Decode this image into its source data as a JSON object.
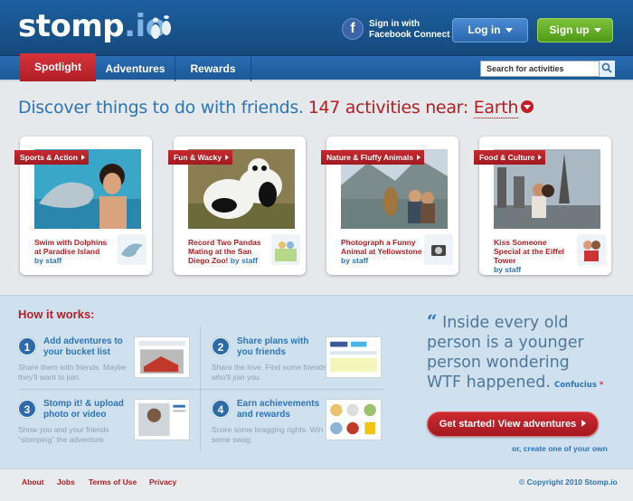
{
  "header": {
    "logo": "stomp",
    "logo_suffix": ".io",
    "facebook": {
      "line1": "Sign in with",
      "line2": "Facebook Connect"
    },
    "login_label": "Log in",
    "signup_label": "Sign up"
  },
  "nav": {
    "tabs": [
      {
        "label": "Spotlight",
        "active": true
      },
      {
        "label": "Adventures",
        "active": false
      },
      {
        "label": "Rewards",
        "active": false
      }
    ],
    "search_placeholder": "Search for activities"
  },
  "headline": {
    "text": "Discover things to do with friends.",
    "count": "147 activities near:",
    "location": "Earth"
  },
  "cards": [
    {
      "tag": "Sports & Action",
      "title": "Swim with Dolphins at Paradise Island",
      "by": "by staff"
    },
    {
      "tag": "Fun & Wacky",
      "title": "Record Two Pandas Mating at the San Diego Zoo!",
      "by": "by staff"
    },
    {
      "tag": "Nature & Fluffy Animals",
      "title": "Photograph a Funny Animal at Yellowstone",
      "by": "by staff"
    },
    {
      "tag": "Food & Culture",
      "title": "Kiss Someone Special at the Eiffel Tower",
      "by": "by staff"
    }
  ],
  "how": {
    "title": "How it works:",
    "steps": [
      {
        "num": "1",
        "title": "Add adventures to your bucket list",
        "desc": "Share them with friends. Maybe they'll want to join."
      },
      {
        "num": "2",
        "title": "Share plans with you friends",
        "desc": "Share the love. Find some friends who'll join you."
      },
      {
        "num": "3",
        "title": "Stomp it! & upload photo or video",
        "desc": "Show you and your friends “stomping” the adventure."
      },
      {
        "num": "4",
        "title": "Earn achievements and rewards",
        "desc": "Score some bragging rights. Win some swag."
      }
    ]
  },
  "quote": {
    "mark": "“",
    "text": "Inside every old person is a younger person wondering WTF happened.",
    "author": "Confucius"
  },
  "cta": {
    "label": "Get started! View adventures",
    "or": "or,",
    "alt": "create one of your own"
  },
  "footer": {
    "links": [
      "About",
      "Jobs",
      "Terms of Use",
      "Privacy"
    ],
    "copyright": "© Copyright 2010 Stomp.io"
  }
}
